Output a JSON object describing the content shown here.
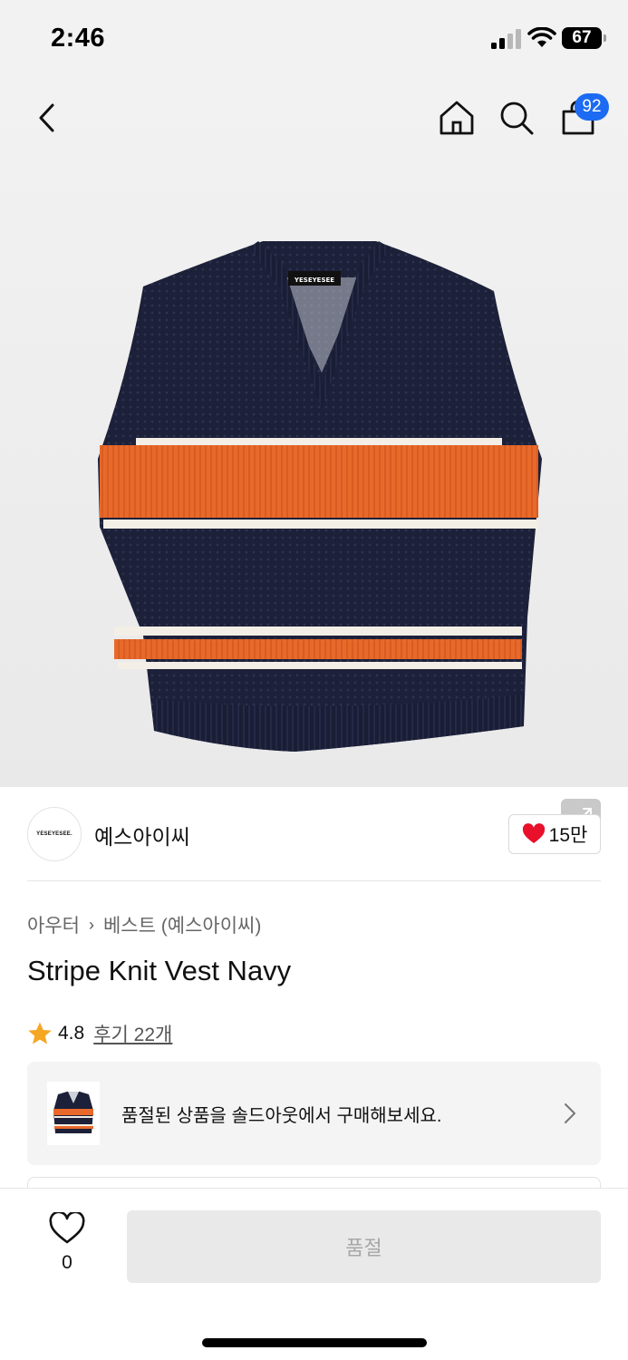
{
  "status_bar": {
    "time": "2:46",
    "battery": "67"
  },
  "header": {
    "cart_badge": "92"
  },
  "brand": {
    "logo_text": "YESEYESEE.",
    "name": "예스아이씨",
    "likes": "15만"
  },
  "breadcrumb": {
    "category": "아우터",
    "sub": "베스트 (예스아이씨)"
  },
  "product": {
    "title": "Stripe Knit Vest Navy",
    "rating": "4.8",
    "reviews": "후기 22개"
  },
  "soldout_banner": {
    "text": "품절된 상품을 솔드아웃에서 구매해보세요."
  },
  "bottom": {
    "wish_count": "0",
    "buy_label": "품절"
  },
  "colors": {
    "navy": "#1c2038",
    "orange": "#e8692a",
    "badge_blue": "#1c6bf2",
    "heart_red": "#e8102a",
    "star": "#f5a623"
  },
  "icons": [
    "back-icon",
    "home-icon",
    "search-icon",
    "bag-icon",
    "expand-icon",
    "heart-icon",
    "star-icon",
    "chevron-right-icon",
    "heart-outline-icon"
  ]
}
